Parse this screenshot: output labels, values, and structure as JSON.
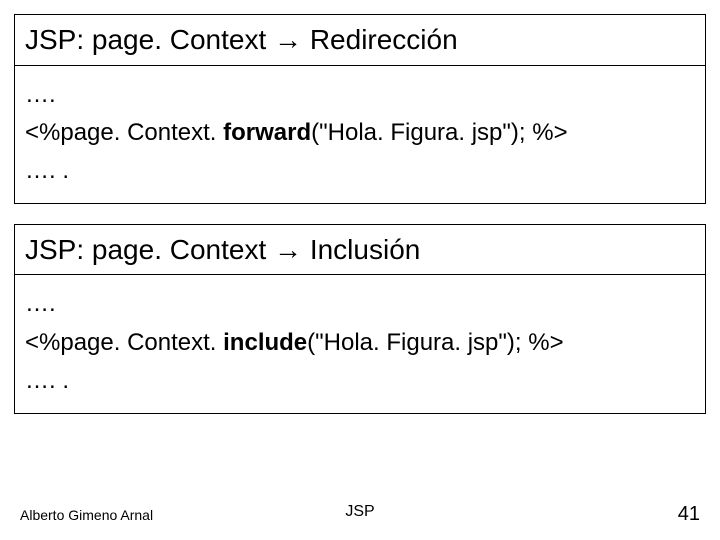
{
  "box1": {
    "title_prefix": "JSP: page. Context ",
    "title_arrow": "→",
    "title_suffix": " Redirección",
    "line1": "….",
    "line2a": "<%page. Context. ",
    "line2b": "forward",
    "line2c": "(\"Hola. Figura. jsp\"); %>",
    "line3": "…. ."
  },
  "box2": {
    "title_prefix": "JSP: page. Context ",
    "title_arrow": "→",
    "title_suffix": " Inclusión",
    "line1": "….",
    "line2a": "<%page. Context. ",
    "line2b": "include",
    "line2c": "(\"Hola. Figura. jsp\"); %>",
    "line3": "…. ."
  },
  "footer": {
    "left": "Alberto Gimeno Arnal",
    "center": "JSP",
    "right": "41"
  }
}
